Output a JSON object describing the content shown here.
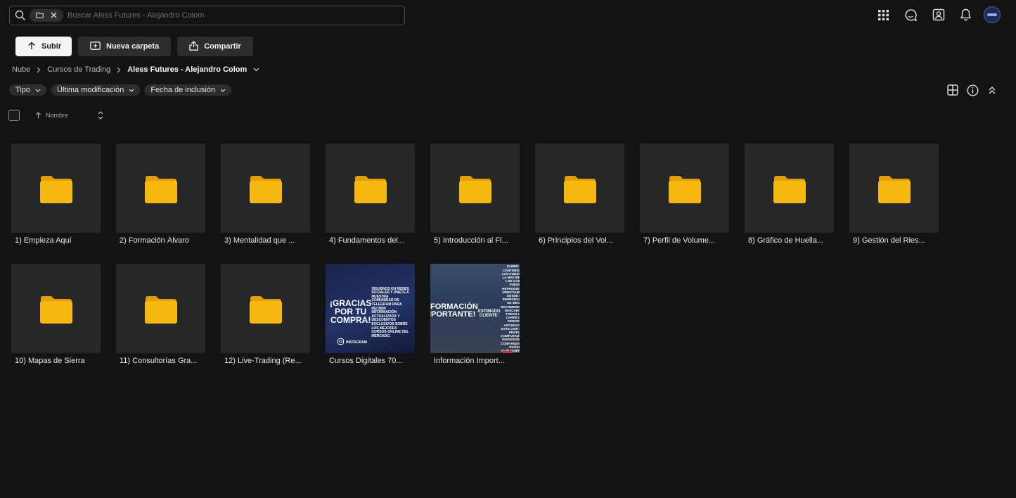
{
  "search": {
    "placeholder": "Buscar Aless Futures - Alejandro Colom",
    "value": ""
  },
  "toolbar": {
    "upload_label": "Subir",
    "new_folder_label": "Nueva carpeta",
    "share_label": "Compartir"
  },
  "breadcrumb": {
    "items": [
      "Nube",
      "Cursos de Trading"
    ],
    "current": "Aless Futures - Alejandro Colom"
  },
  "filters": {
    "type": "Tipo",
    "last_modified": "Última modificación",
    "date_added": "Fecha de inclusión"
  },
  "list_header": {
    "name_column": "Nombre"
  },
  "items": [
    {
      "name": "1) Empieza Aquí",
      "kind": "folder"
    },
    {
      "name": "2) Formación Álvaro",
      "kind": "folder"
    },
    {
      "name": "3) Mentalidad que ...",
      "kind": "folder"
    },
    {
      "name": "4) Fundamentos del...",
      "kind": "folder"
    },
    {
      "name": "5) Introducción al Fl...",
      "kind": "folder"
    },
    {
      "name": "6) Principios del Vol...",
      "kind": "folder"
    },
    {
      "name": "7) Perfil de Volume...",
      "kind": "folder"
    },
    {
      "name": "8) Gráfico de Huella...",
      "kind": "folder"
    },
    {
      "name": "9) Gestión del Ries...",
      "kind": "folder"
    },
    {
      "name": "10) Mapas de Sierra",
      "kind": "folder"
    },
    {
      "name": "11) Consultorías Gra...",
      "kind": "folder"
    },
    {
      "name": "12) Live-Trading (Re...",
      "kind": "folder"
    },
    {
      "name": "Cursos Digitales 70...",
      "kind": "image"
    },
    {
      "name": "Información Import...",
      "kind": "image"
    }
  ],
  "promo_image": {
    "heading": "¡GRACIAS POR TU COMPRA!",
    "body": "SÍGUENOS EN REDES SOCIALES Y ÚNETE A NUESTRA COMUNIDAD DE TELEGRAM PARA RECIBIR INFORMACIÓN ACTUALIZADA Y DESCUENTOS EXCLUSIVOS SOBRE LOS MEJORES CURSOS ONLINE DEL MERCADO.",
    "insta": "INSTAGRAM"
  },
  "info_image": {
    "heading": "¡INFORMACIÓN IMPORTANTE!",
    "sub": "ESTIMADO CLIENTE:",
    "body": "SI BIEN EL CONTENIDO DE LOS CURSOS EN LA MAYORÍA DE LOS CASOS PUEDE REPRODUCIRSE DIRECTAMENTE DESDE EL REPRODUCTOR DE MEGA, RECOMENDAMOS DESCARGAR TODAS LAS CARPETAS, VIDEOS O ARCHIVOS DE ESTE LINK EN SU PROPIA COMPUTADORA O DISPOSITIVO DE CONFIANZA PARA EVITAR CUALQUIER TIPO DE INCONVENIENTES."
  },
  "colors": {
    "background": "#121314",
    "tile": "#262729",
    "folder": "#f7b90f",
    "folder_dark": "#e59d07"
  },
  "icons": {
    "top": [
      "apps-grid-icon",
      "chat-icon",
      "contacts-icon",
      "bell-icon"
    ],
    "view": [
      "grid-view-icon",
      "info-icon",
      "collapse-icon"
    ]
  }
}
